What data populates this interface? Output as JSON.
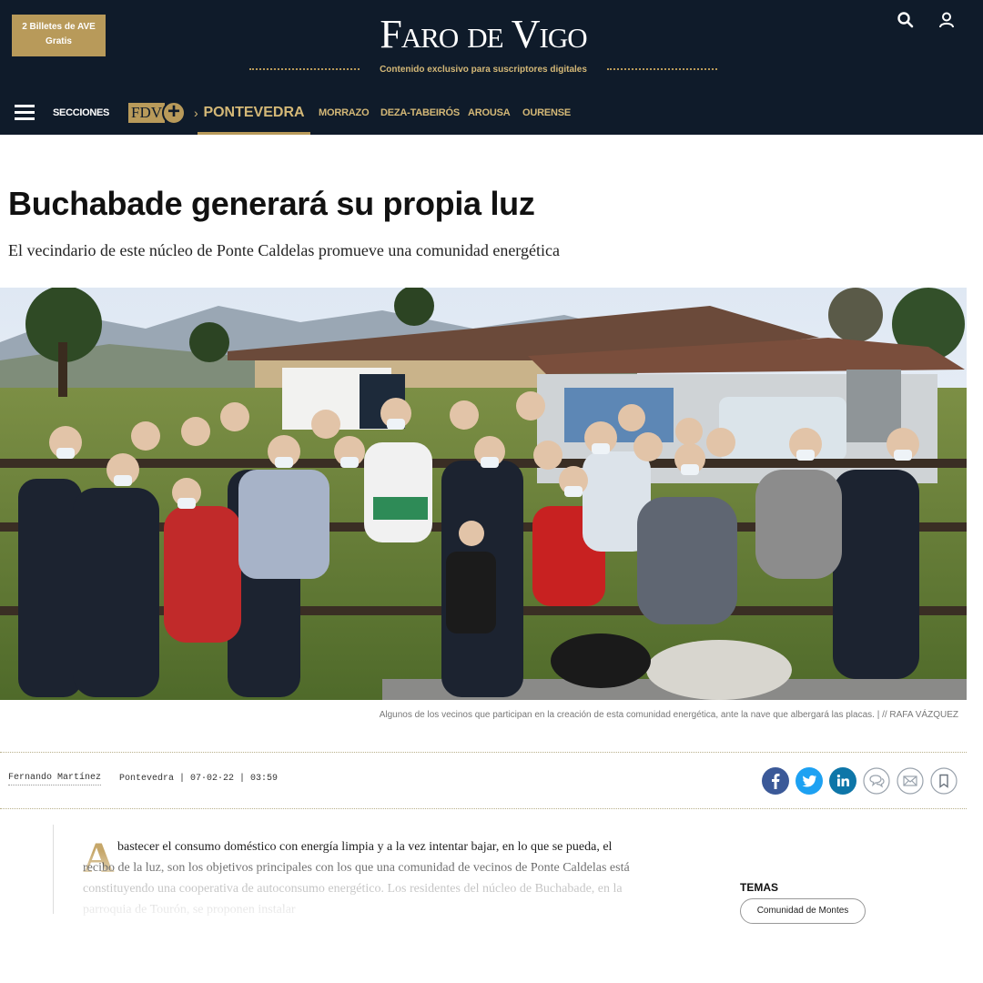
{
  "header": {
    "promo": {
      "line1": "2 Billetes de AVE",
      "line2": "Gratis"
    },
    "logo": "Faro de Vigo",
    "tagline": "Contenido exclusivo para suscriptores digitales",
    "icons": {
      "search": "search-icon",
      "user": "user-icon"
    }
  },
  "nav": {
    "sections_label": "SECCIONES",
    "fdv_text": "FDV",
    "fdv_plus": "+",
    "breadcrumb_sep": "›",
    "current": "PONTEVEDRA",
    "items": [
      "MORRAZO",
      "DEZA-TABEIRÓS",
      "AROUSA",
      "OURENSE"
    ]
  },
  "article": {
    "headline": "Buchabade generará su propia luz",
    "subtitle": "El vecindario de este núcleo de Ponte Caldelas promueve una comunidad energética",
    "caption": "Algunos de los vecinos que participan en la creación de esta comunidad energética, ante la nave que albergará las placas. | // RAFA VÁZQUEZ",
    "author": "Fernando Martínez",
    "dateline": "Pontevedra | 07·02·22 | 03:59",
    "dropcap": "A",
    "body": "bastecer el consumo doméstico con energía limpia y a la vez intentar bajar, en lo que se pueda, el recibo de la luz, son los objetivos principales con los que una comunidad de vecinos de Ponte Caldelas está constituyendo una cooperativa de autoconsumo energético. Los residentes del núcleo de Buchabade, en la parroquia de Tourón, se proponen instalar"
  },
  "share": [
    "facebook-icon",
    "twitter-icon",
    "linkedin-icon",
    "comments-icon",
    "email-icon",
    "bookmark-icon"
  ],
  "temas": {
    "title": "TEMAS",
    "tag": "Comunidad de Montes"
  },
  "colors": {
    "header_bg": "#0f1b2a",
    "accent_gold": "#b89a5a",
    "facebook": "#3b5998",
    "twitter": "#1da1f2",
    "linkedin": "#0e76a8"
  }
}
